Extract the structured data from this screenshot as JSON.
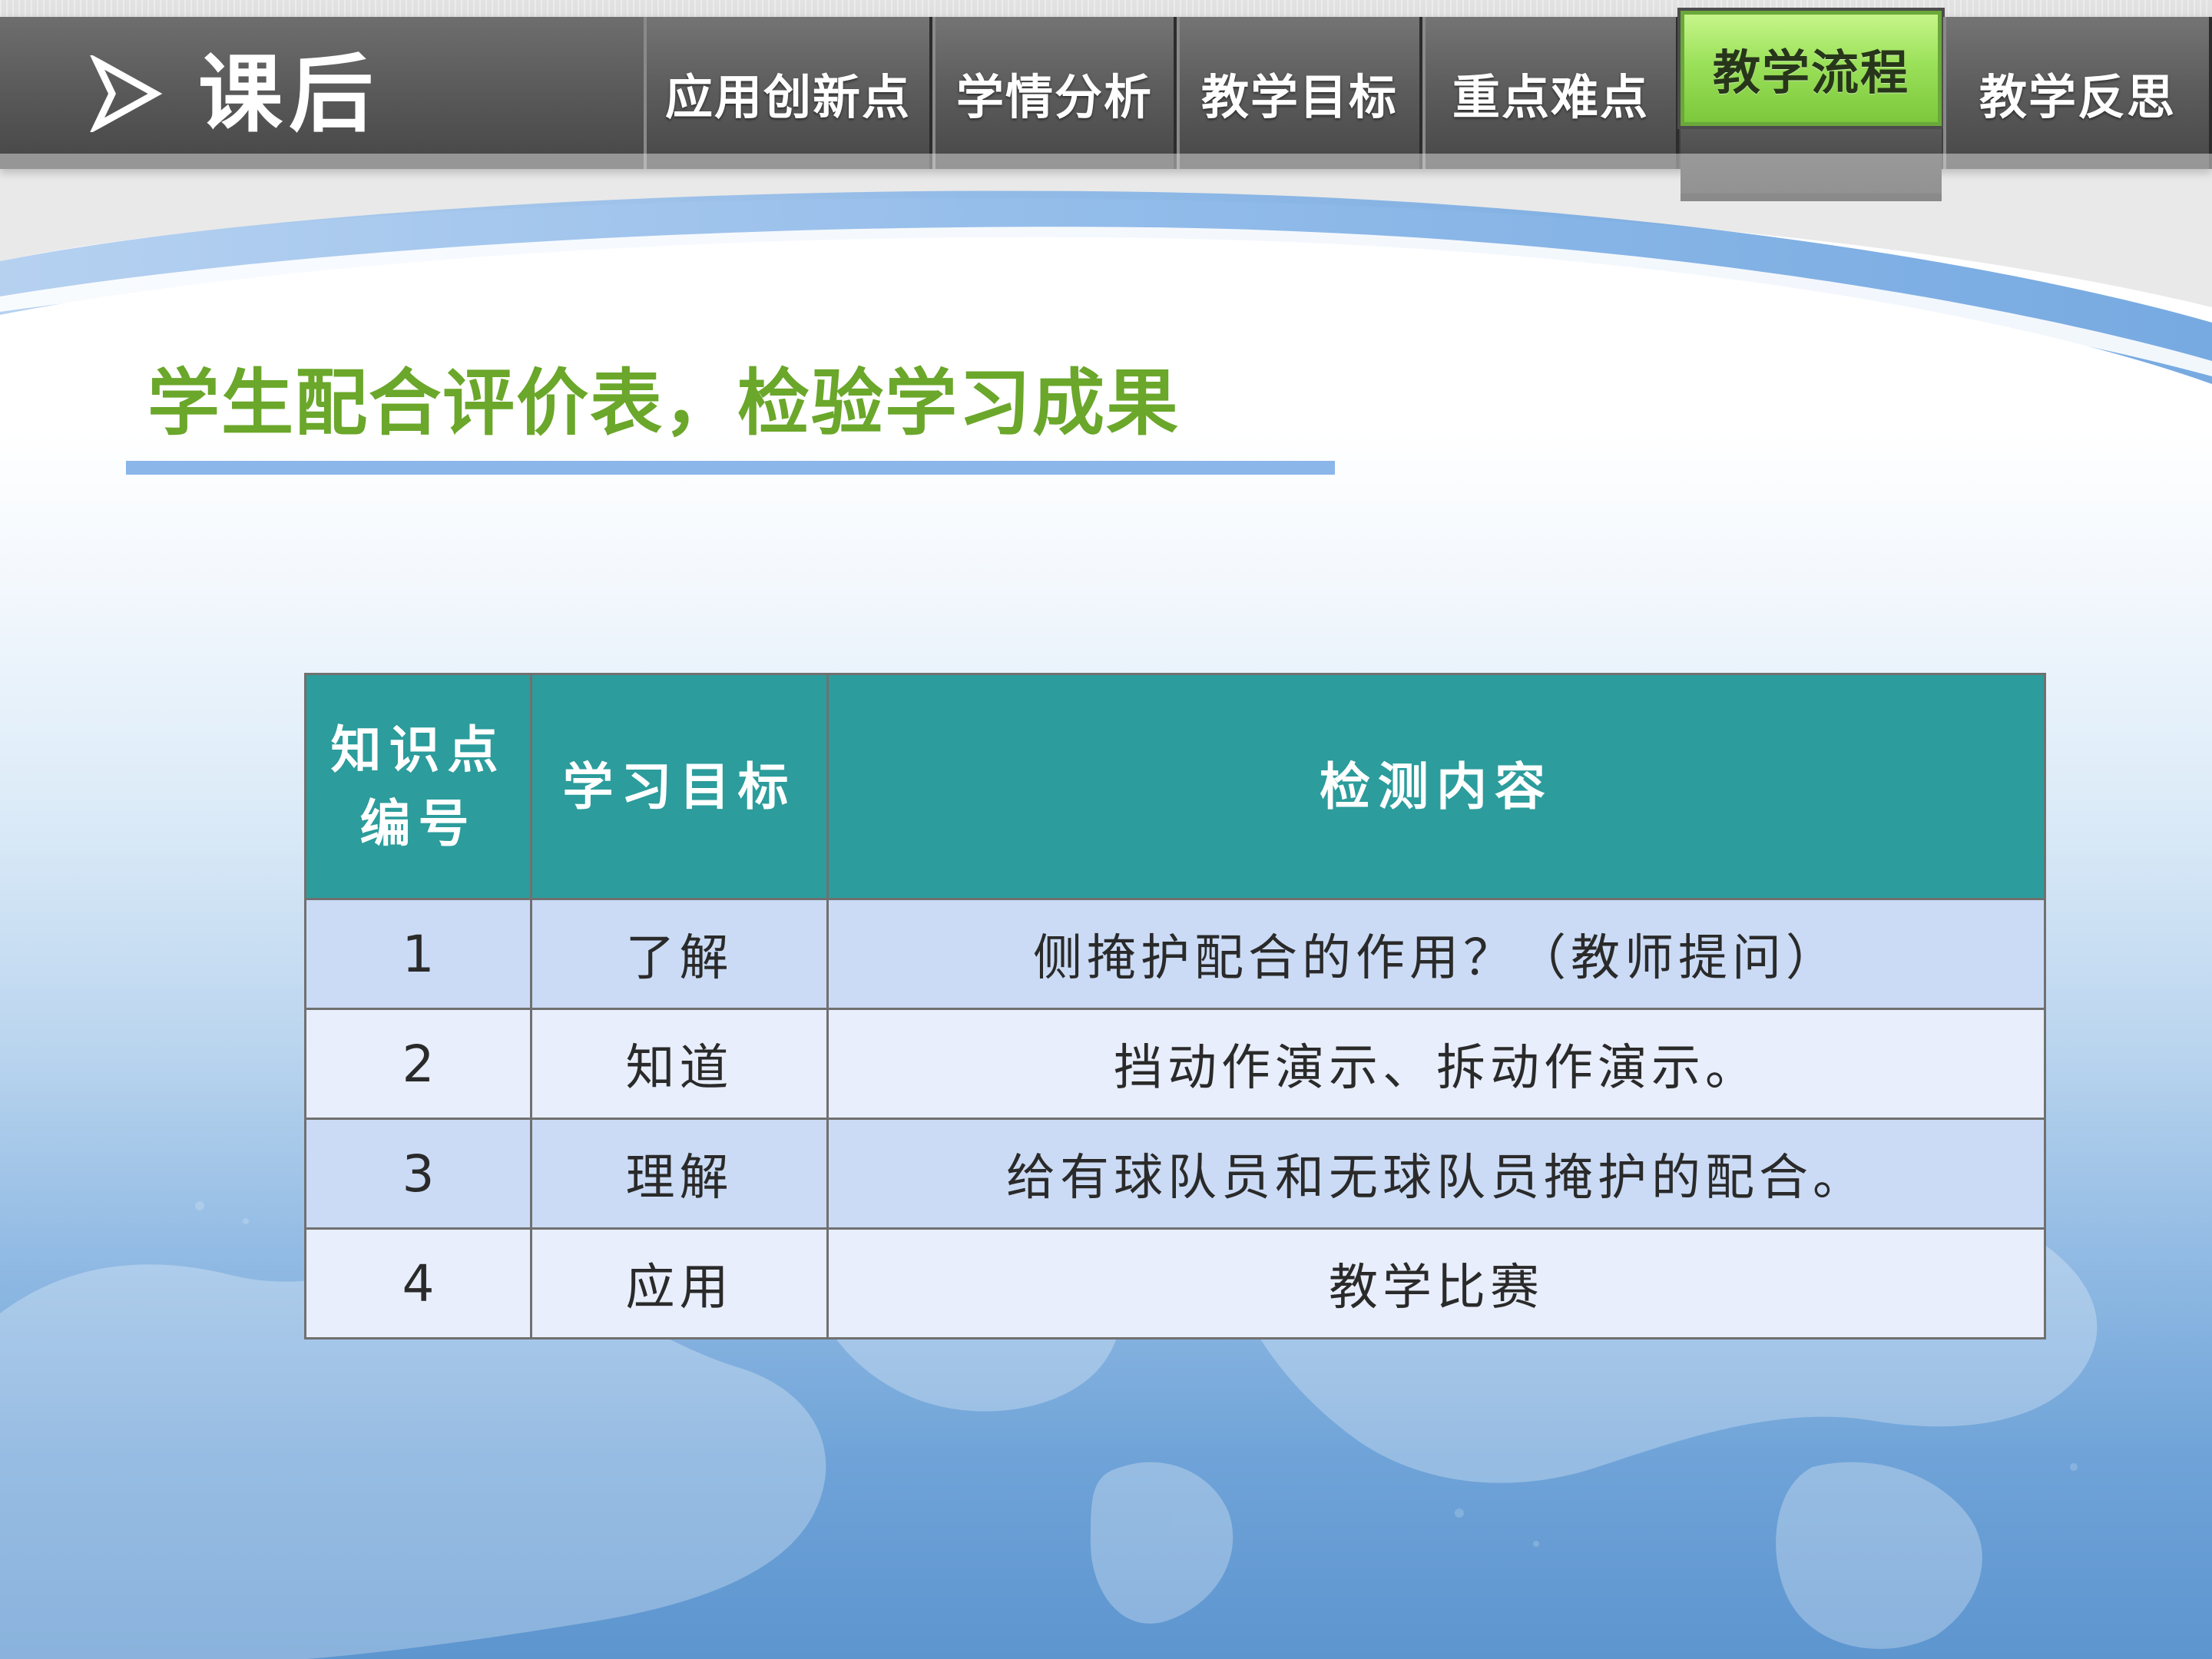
{
  "header": {
    "section_title": "课后",
    "tabs": [
      {
        "label": "应用创新点",
        "active": false
      },
      {
        "label": "学情分析",
        "active": false
      },
      {
        "label": "教学目标",
        "active": false
      },
      {
        "label": "重点难点",
        "active": false
      },
      {
        "label": "教学流程",
        "active": true
      },
      {
        "label": "教学反思",
        "active": false
      }
    ]
  },
  "slide": {
    "heading": "学生配合评价表，检验学习成果"
  },
  "table": {
    "headers": {
      "col1_line1": "知识点",
      "col1_line2": "编号",
      "col2": "学习目标",
      "col3": "检测内容"
    },
    "rows": [
      {
        "num": "1",
        "goal": "了解",
        "content": "侧掩护配合的作用？（教师提问）"
      },
      {
        "num": "2",
        "goal": "知道",
        "content": "挡动作演示、拆动作演示。"
      },
      {
        "num": "3",
        "goal": "理解",
        "content": "给有球队员和无球队员掩护的配合。"
      },
      {
        "num": "4",
        "goal": "应用",
        "content": "教学比赛"
      }
    ]
  },
  "colors": {
    "header_dark": "#4a4a4a",
    "active_tab": "#9be15a",
    "heading_green": "#6aa72a",
    "underline_blue": "#8bb6ea",
    "table_header": "#2c9c9c",
    "row_odd": "#cbdbf5",
    "row_even": "#e8eefb"
  },
  "icons": {
    "section_marker": "arrow-right-outline-icon",
    "background": "world-map-icon"
  }
}
